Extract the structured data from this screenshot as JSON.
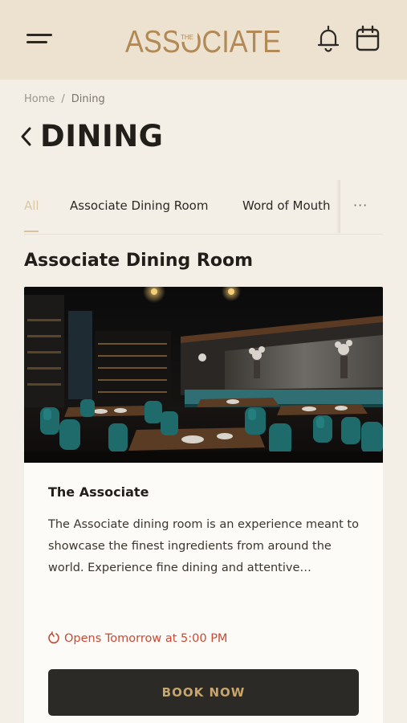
{
  "header": {
    "logo_text": "ASSOCIATE",
    "logo_small": "THE",
    "icons": {
      "menu": "hamburger-icon",
      "notifications": "bell-icon",
      "reservations": "calendar-icon"
    }
  },
  "breadcrumb": {
    "home": "Home",
    "separator": "/",
    "current": "Dining"
  },
  "page": {
    "title": "DINING"
  },
  "tabs": [
    {
      "label": "All",
      "active": true
    },
    {
      "label": "Associate Dining Room",
      "active": false
    },
    {
      "label": "Word of Mouth",
      "active": false
    }
  ],
  "tabs_more": "···",
  "section": {
    "title": "Associate Dining Room"
  },
  "card": {
    "title": "The Associate",
    "description": "The Associate dining room is an experience meant to showcase the finest ingredients from around the world. Experience fine dining and attentive…",
    "status": "Opens Tomorrow at 5:00 PM",
    "button": "BOOK NOW"
  },
  "colors": {
    "header_bg": "#ede2d0",
    "page_bg": "#f4efe6",
    "accent_gold": "#c8a56b",
    "status_red": "#c94a35",
    "button_bg": "#2b2a26"
  }
}
